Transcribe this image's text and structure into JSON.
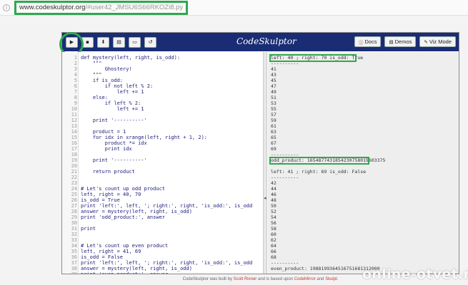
{
  "browser": {
    "url_domain": "www.codeskulptor.org",
    "url_path": "/#user42_JMSU6S66RKOZi8.py"
  },
  "toolbar": {
    "brand": "CodeSkulptor",
    "buttons": [
      {
        "icon": "play-icon",
        "glyph": "▶"
      },
      {
        "icon": "save-icon",
        "glyph": "▪"
      },
      {
        "icon": "download-icon",
        "glyph": "⬇"
      },
      {
        "icon": "print-icon",
        "glyph": "▤"
      },
      {
        "icon": "folder-icon",
        "glyph": "▭"
      },
      {
        "icon": "reset-icon",
        "glyph": "↺"
      }
    ],
    "docs_label": "Docs",
    "demos_label": "Demos",
    "vizmode_label": "Viz Mode"
  },
  "code": [
    "def mystery(left, right, is_odd):",
    "    \"\"\"",
    "        Ghostery!",
    "    \"\"\"",
    "    if is_odd:",
    "        if not left % 2:",
    "            left += 1",
    "    else:",
    "        if left % 2:",
    "            left += 1",
    "",
    "    print '----------'",
    "",
    "    product = 1",
    "    for idx in xrange(left, right + 1, 2):",
    "        product *= idx",
    "        print idx",
    "",
    "    print '----------'",
    "",
    "    return product",
    "",
    "",
    "# Let's count up odd product",
    "left, right = 40, 70",
    "is_odd = True",
    "print 'left:', left, '; right:', right, 'is_odd:', is_odd",
    "answer = mystery(left, right, is_odd)",
    "print 'odd_product:', answer",
    "",
    "print",
    "",
    "",
    "# Let's count up even product",
    "left, right = 41, 69",
    "is_odd = False",
    "print 'left:', left, '; right:', right, 'is_odd:', is_odd",
    "answer = mystery(left, right, is_odd)",
    "print 'even_product:', answer"
  ],
  "output": [
    "left: 40 ; right: 70 is_odd: True",
    "----------",
    "41",
    "43",
    "45",
    "47",
    "49",
    "51",
    "53",
    "55",
    "57",
    "59",
    "61",
    "63",
    "65",
    "67",
    "69",
    "----------",
    "odd_product: 1654877431854230758019603375",
    "",
    "left: 41 ; right: 69 is_odd: False",
    "----------",
    "42",
    "44",
    "46",
    "48",
    "50",
    "52",
    "54",
    "56",
    "58",
    "60",
    "62",
    "64",
    "66",
    "68",
    "----------",
    "even_product: 1988199364516751681312000"
  ],
  "footer": {
    "t1": "CodeSkulptor was built by ",
    "l1": "Scott Rixner",
    "t2": " and is based upon ",
    "l2": "CodeMirror",
    "t3": " and ",
    "l3": "Skulpt",
    "t4": "."
  },
  "watermark": "online-otvet.ru",
  "colors": {
    "toolbar": "#1a2c74",
    "highlight": "#2fa84f"
  }
}
